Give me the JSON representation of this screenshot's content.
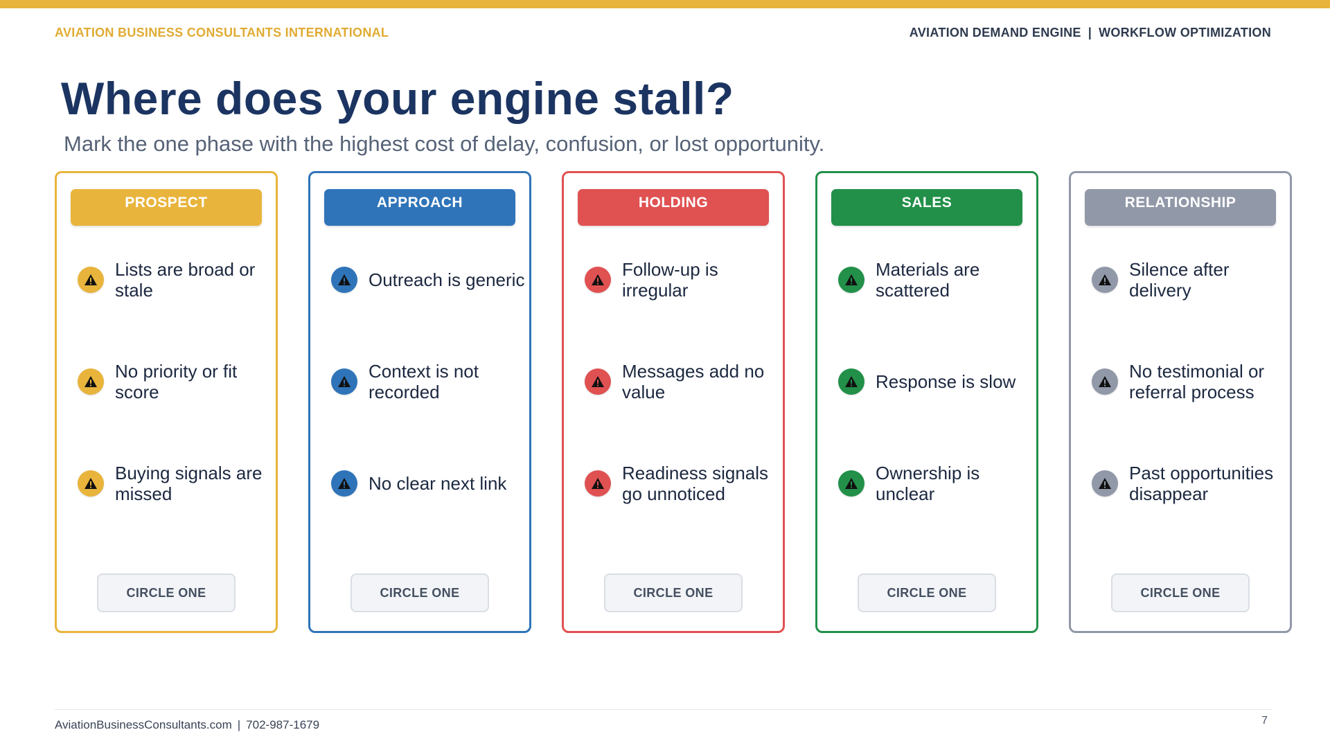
{
  "header": {
    "brand": "AVIATION BUSINESS CONSULTANTS INTERNATIONAL",
    "product": "AVIATION DEMAND ENGINE",
    "separator": "|",
    "section": "WORKFLOW OPTIMIZATION"
  },
  "title": "Where does your engine stall?",
  "subtitle": "Mark the one phase with the highest cost of delay, confusion, or lost opportunity.",
  "icon": "warning-triangle-icon",
  "phases": [
    {
      "name": "PROSPECT",
      "color": "#e8b43c",
      "items": [
        "Lists are broad or stale",
        "No priority or fit score",
        "Buying signals are missed"
      ],
      "button": "CIRCLE ONE"
    },
    {
      "name": "APPROACH",
      "color": "#2f74b8",
      "items": [
        "Outreach is generic",
        "Context is not recorded",
        "No clear next link"
      ],
      "button": "CIRCLE ONE"
    },
    {
      "name": "HOLDING",
      "color": "#e05152",
      "items": [
        "Follow-up is irregular",
        "Messages add no value",
        "Readiness signals go unnoticed"
      ],
      "button": "CIRCLE ONE"
    },
    {
      "name": "SALES",
      "color": "#229049",
      "items": [
        "Materials are scattered",
        "Response is slow",
        "Ownership is unclear"
      ],
      "button": "CIRCLE ONE"
    },
    {
      "name": "RELATIONSHIP",
      "color": "#9198a8",
      "items": [
        "Silence after delivery",
        "No testimonial or referral process",
        "Past opportunities disappear"
      ],
      "button": "CIRCLE ONE"
    }
  ],
  "footer": {
    "website": "AviationBusinessConsultants.com",
    "separator": "|",
    "phone": "702-987-1679",
    "page_number": "7"
  }
}
